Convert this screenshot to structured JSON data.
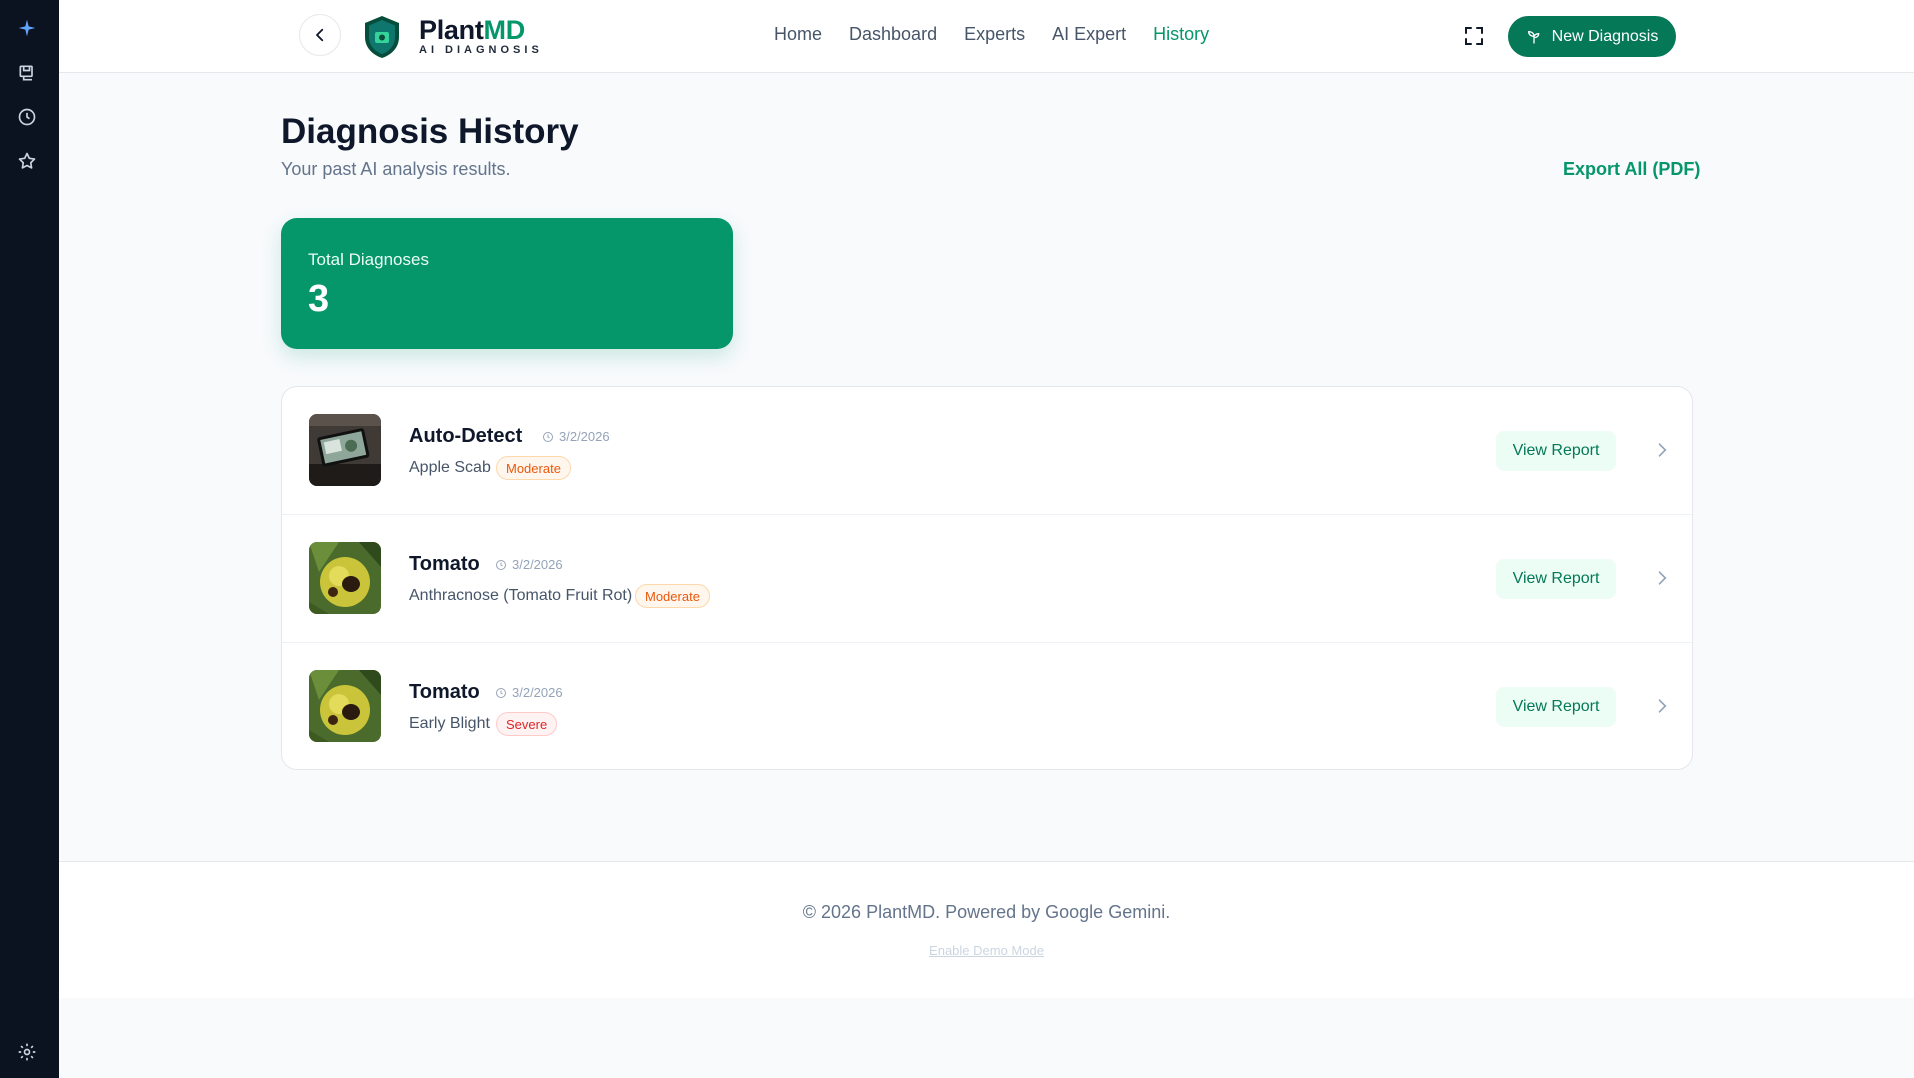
{
  "rail": {
    "icons": [
      "sparkle-icon",
      "save-icon",
      "clock-icon",
      "star-icon",
      "gear-icon"
    ]
  },
  "header": {
    "brand_main": "Plant",
    "brand_accent": "MD",
    "brand_sub": "AI DIAGNOSIS",
    "nav": [
      {
        "label": "Home"
      },
      {
        "label": "Dashboard"
      },
      {
        "label": "Experts"
      },
      {
        "label": "AI Expert"
      },
      {
        "label": "History",
        "active": true
      }
    ],
    "new_button": "New Diagnosis"
  },
  "page": {
    "title": "Diagnosis History",
    "subtitle": "Your past AI analysis results.",
    "export": "Export All (PDF)"
  },
  "stats": {
    "label": "Total Diagnoses",
    "value": "3"
  },
  "history": [
    {
      "crop": "Auto-Detect",
      "date": "3/2/2026",
      "diagnosis": "Apple Scab",
      "severity": "Moderate",
      "action": "View Report"
    },
    {
      "crop": "Tomato",
      "date": "3/2/2026",
      "diagnosis": "Anthracnose (Tomato Fruit Rot)",
      "severity": "Moderate",
      "action": "View Report"
    },
    {
      "crop": "Tomato",
      "date": "3/2/2026",
      "diagnosis": "Early Blight",
      "severity": "Severe",
      "action": "View Report"
    }
  ],
  "footer": {
    "copyright": "© 2026 PlantMD. Powered by Google Gemini.",
    "demo_link": "Enable Demo Mode"
  },
  "colors": {
    "accent": "#059669",
    "rail": "#0b1220",
    "moderate": "#ea580c",
    "severe": "#dc2626"
  }
}
